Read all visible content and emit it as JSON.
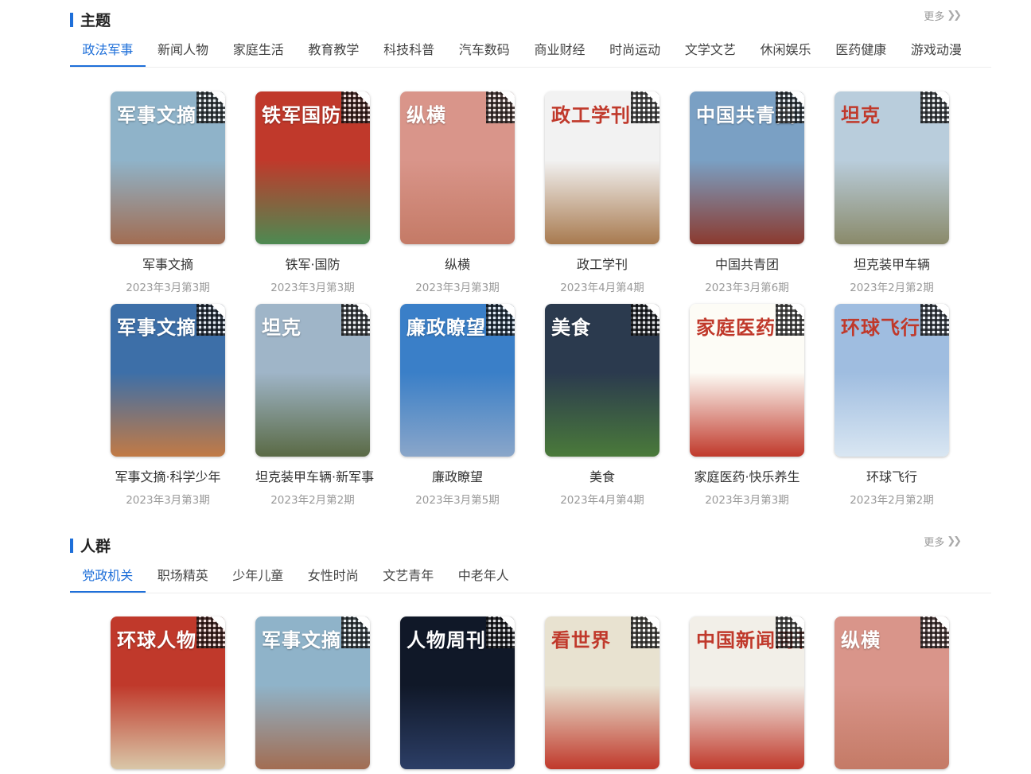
{
  "section1": {
    "title": "主题",
    "more": "更多",
    "tabs": [
      "政法军事",
      "新闻人物",
      "家庭生活",
      "教育教学",
      "科技科普",
      "汽车数码",
      "商业财经",
      "时尚运动",
      "文学文艺",
      "休闲娱乐",
      "医药健康",
      "游戏动漫"
    ],
    "active_tab": 0,
    "magazines": [
      {
        "name": "军事文摘",
        "date": "2023年3月第3期",
        "cover": "军事文摘",
        "bg": "#8fb3c9",
        "bg2": "#a26d52"
      },
      {
        "name": "铁军·国防",
        "date": "2023年3月第3期",
        "cover": "铁军国防",
        "bg": "#c0392b",
        "bg2": "#4d8a52"
      },
      {
        "name": "纵横",
        "date": "2023年3月第3期",
        "cover": "纵横",
        "bg": "#d9958a",
        "bg2": "#c47a66"
      },
      {
        "name": "政工学刊",
        "date": "2023年4月第4期",
        "cover": "政工学刊",
        "bg": "#f2f2f2",
        "bg2": "#a87a4f"
      },
      {
        "name": "中国共青团",
        "date": "2023年3月第6期",
        "cover": "中国共青团",
        "bg": "#7aa0c4",
        "bg2": "#8b3a2f"
      },
      {
        "name": "坦克装甲车辆",
        "date": "2023年2月第2期",
        "cover": "坦克",
        "bg": "#b9cddc",
        "bg2": "#8a8a6a"
      },
      {
        "name": "军事文摘·科学少年",
        "date": "2023年3月第3期",
        "cover": "军事文摘",
        "bg": "#3d6fa8",
        "bg2": "#c27a45"
      },
      {
        "name": "坦克装甲车辆·新军事",
        "date": "2023年2月第2期",
        "cover": "坦克",
        "bg": "#9fb5c8",
        "bg2": "#5a6a45"
      },
      {
        "name": "廉政瞭望",
        "date": "2023年3月第5期",
        "cover": "廉政瞭望",
        "bg": "#3a7fc8",
        "bg2": "#8aa6c9"
      },
      {
        "name": "美食",
        "date": "2023年4月第4期",
        "cover": "美食",
        "bg": "#2b3a4e",
        "bg2": "#4a7a3a"
      },
      {
        "name": "家庭医药·快乐养生",
        "date": "2023年3月第3期",
        "cover": "家庭医药",
        "bg": "#fdfcf6",
        "bg2": "#c0392b"
      },
      {
        "name": "环球飞行",
        "date": "2023年2月第2期",
        "cover": "环球飞行",
        "bg": "#9fbde0",
        "bg2": "#d9e6f2"
      }
    ]
  },
  "section2": {
    "title": "人群",
    "more": "更多",
    "tabs": [
      "党政机关",
      "职场精英",
      "少年儿童",
      "女性时尚",
      "文艺青年",
      "中老年人"
    ],
    "active_tab": 0,
    "magazines": [
      {
        "cover": "环球人物",
        "bg": "#c0392b",
        "bg2": "#d9c7a8"
      },
      {
        "cover": "军事文摘",
        "bg": "#8fb3c9",
        "bg2": "#a26d52"
      },
      {
        "cover": "人物周刊",
        "bg": "#101828",
        "bg2": "#2c3e66"
      },
      {
        "cover": "看世界",
        "bg": "#e8e2d0",
        "bg2": "#c0392b"
      },
      {
        "cover": "中国新闻周刊",
        "bg": "#f2efe8",
        "bg2": "#c0392b"
      },
      {
        "cover": "纵横",
        "bg": "#d9958a",
        "bg2": "#c47a66"
      }
    ]
  },
  "colors": {
    "accent": "#1e6fd9"
  },
  "icons": {
    "more": "chevron-double-right-icon",
    "qr": "qr-code-icon"
  }
}
